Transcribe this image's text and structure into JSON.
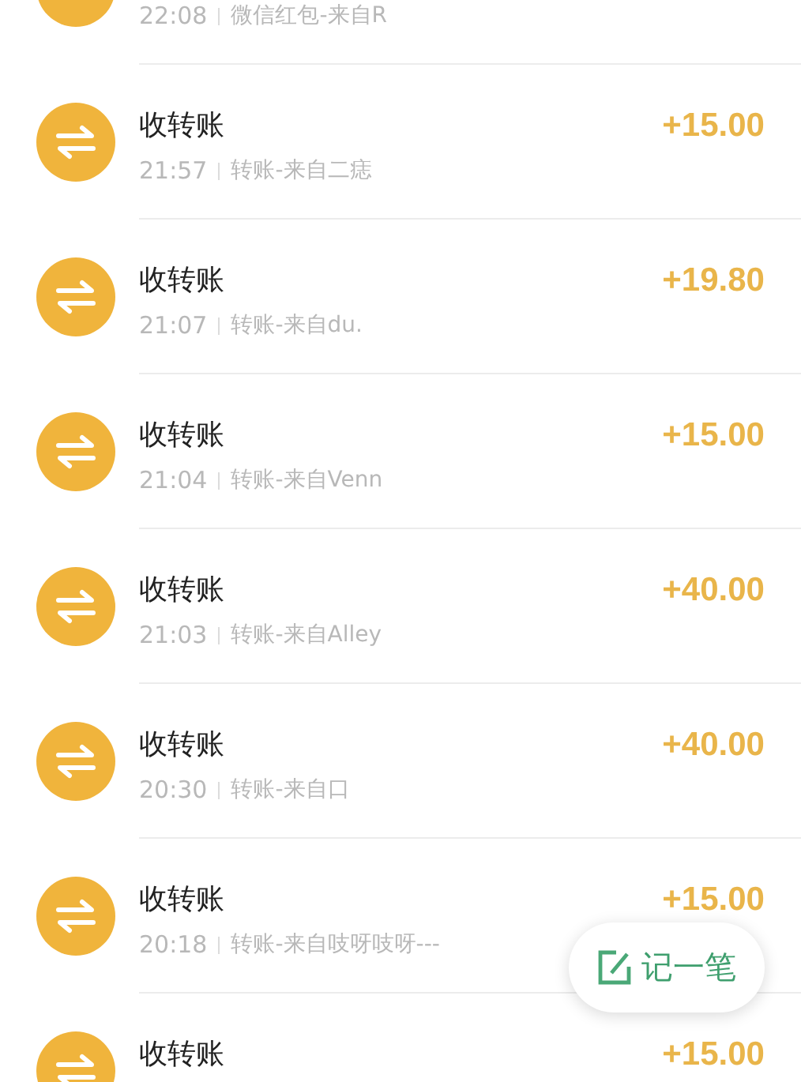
{
  "transactions": [
    {
      "kind": "red_packet",
      "time": "22:08",
      "description": "微信红包-来自R"
    },
    {
      "kind": "transfer",
      "title": "收转账",
      "amount": "+15.00",
      "time": "21:57",
      "description": "转账-来自二痣"
    },
    {
      "kind": "transfer",
      "title": "收转账",
      "amount": "+19.80",
      "time": "21:07",
      "description": "转账-来自du."
    },
    {
      "kind": "transfer",
      "title": "收转账",
      "amount": "+15.00",
      "time": "21:04",
      "description": "转账-来自Venn"
    },
    {
      "kind": "transfer",
      "title": "收转账",
      "amount": "+40.00",
      "time": "21:03",
      "description": "转账-来自Alley"
    },
    {
      "kind": "transfer",
      "title": "收转账",
      "amount": "+40.00",
      "time": "20:30",
      "description": "转账-来自口"
    },
    {
      "kind": "transfer",
      "title": "收转账",
      "amount": "+15.00",
      "time": "20:18",
      "description": "转账-来自吱呀吱呀---"
    },
    {
      "kind": "transfer",
      "title": "收转账",
      "amount": "+15.00"
    }
  ],
  "fab": {
    "label": "记一笔"
  }
}
